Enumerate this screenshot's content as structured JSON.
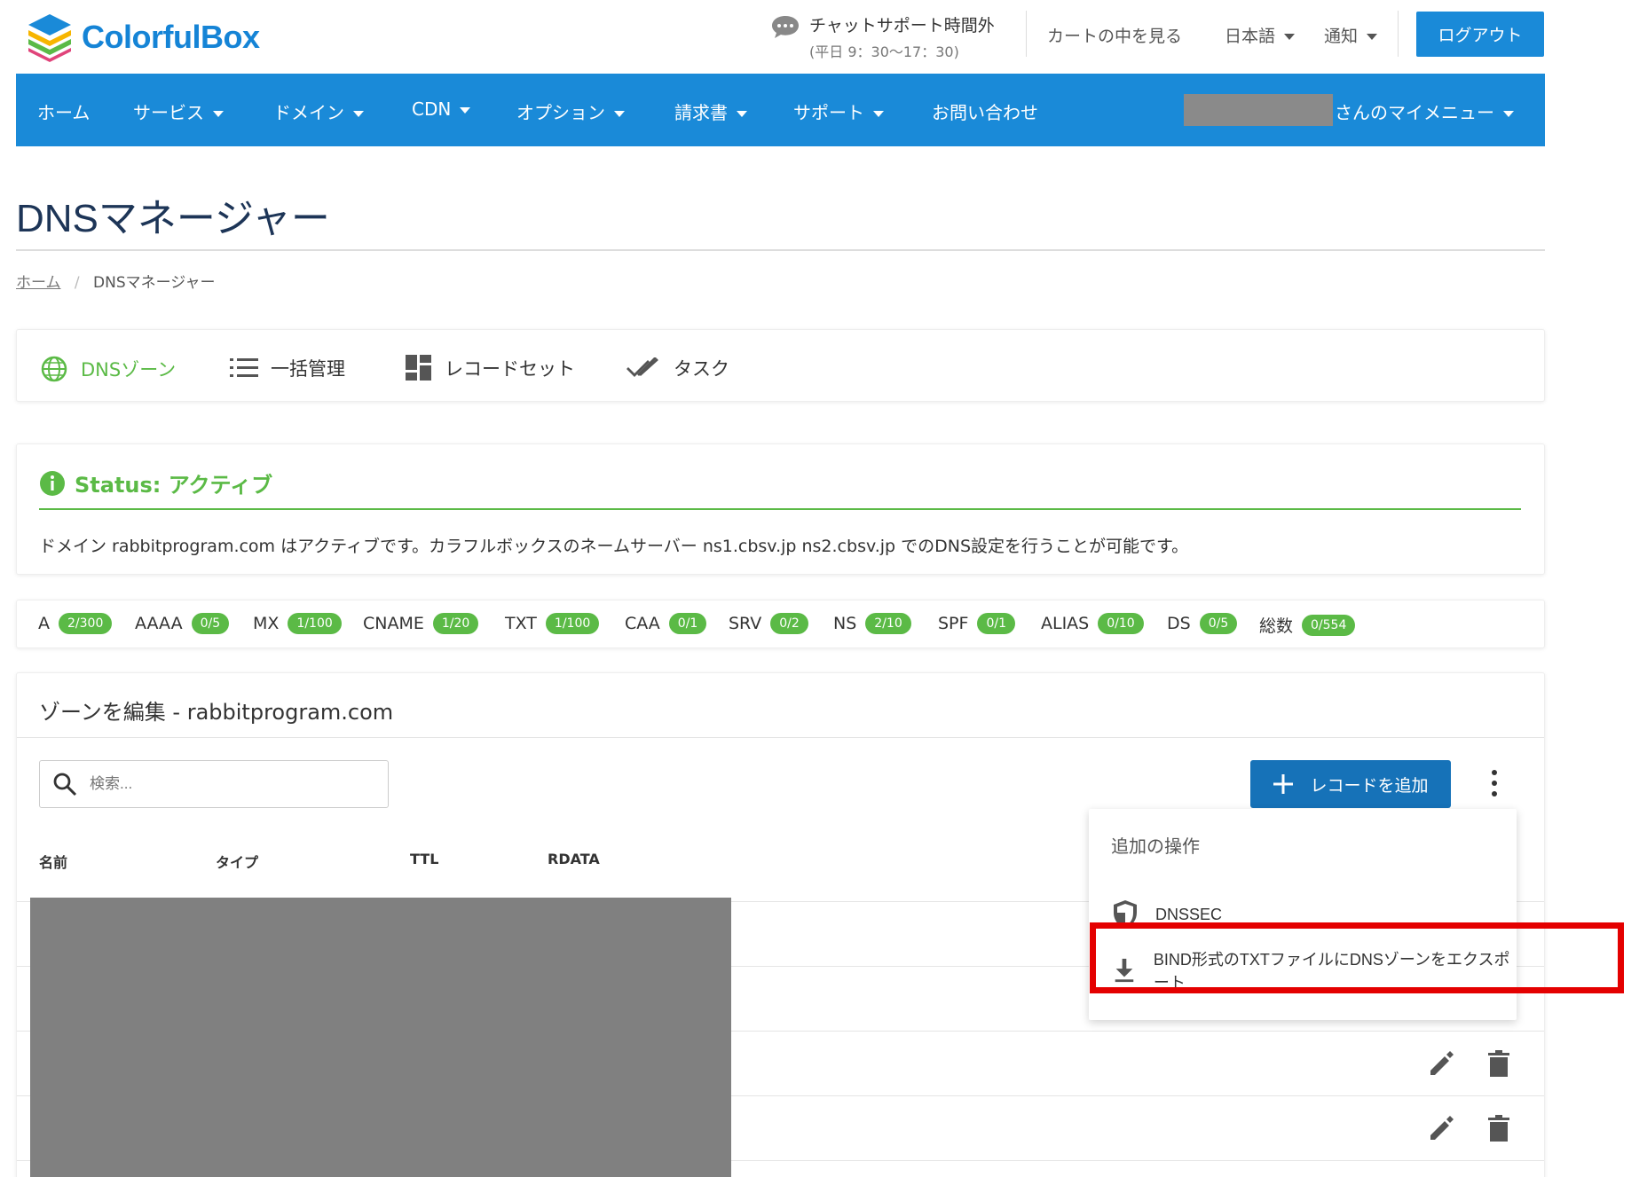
{
  "brand": {
    "name": "ColorfulBox"
  },
  "header": {
    "chat_title": "チャットサポート時間外",
    "chat_hours": "(平日 9：30〜17：30)",
    "cart": "カートの中を見る",
    "language": "日本語",
    "notifications": "通知",
    "logout": "ログアウト"
  },
  "nav": {
    "items": [
      "ホーム",
      "サービス",
      "ドメイン",
      "CDN",
      "オプション",
      "請求書",
      "サポート",
      "お問い合わせ"
    ],
    "user_menu": "さんのマイメニュー"
  },
  "page": {
    "title": "DNSマネージャー"
  },
  "breadcrumb": {
    "home": "ホーム",
    "sep": "/",
    "current": "DNSマネージャー"
  },
  "tabs": [
    {
      "label": "DNSゾーン",
      "icon": "globe-icon",
      "active": true
    },
    {
      "label": "一括管理",
      "icon": "list-icon"
    },
    {
      "label": "レコードセット",
      "icon": "dashboard-icon"
    },
    {
      "label": "タスク",
      "icon": "double-check-icon"
    }
  ],
  "status": {
    "title": "Status: アクティブ",
    "message": "ドメイン rabbitprogram.com はアクティブです。カラフルボックスのネームサーバー ns1.cbsv.jp ns2.cbsv.jp でのDNS設定を行うことが可能です。"
  },
  "record_counts": [
    {
      "type": "A",
      "count": "2/300"
    },
    {
      "type": "AAAA",
      "count": "0/5"
    },
    {
      "type": "MX",
      "count": "1/100"
    },
    {
      "type": "CNAME",
      "count": "1/20"
    },
    {
      "type": "TXT",
      "count": "1/100"
    },
    {
      "type": "CAA",
      "count": "0/1"
    },
    {
      "type": "SRV",
      "count": "0/2"
    },
    {
      "type": "NS",
      "count": "2/10"
    },
    {
      "type": "SPF",
      "count": "0/1"
    },
    {
      "type": "ALIAS",
      "count": "0/10"
    },
    {
      "type": "DS",
      "count": "0/5"
    },
    {
      "type": "総数",
      "count": "0/554"
    }
  ],
  "zone": {
    "heading": "ゾーンを編集 - rabbitprogram.com",
    "search_placeholder": "検索...",
    "add_record": "レコードを追加",
    "columns": [
      "名前",
      "タイプ",
      "TTL",
      "RDATA"
    ]
  },
  "dropdown": {
    "heading": "追加の操作",
    "items": [
      {
        "label": "DNSSEC",
        "icon": "shield-icon"
      },
      {
        "label": "BIND形式のTXTファイルにDNSゾーンをエクスポート",
        "icon": "download-icon"
      }
    ]
  },
  "colors": {
    "brand_blue": "#1a8ad8",
    "success_green": "#5bba46",
    "highlight_red": "#e40000",
    "button_blue": "#1672b8"
  }
}
